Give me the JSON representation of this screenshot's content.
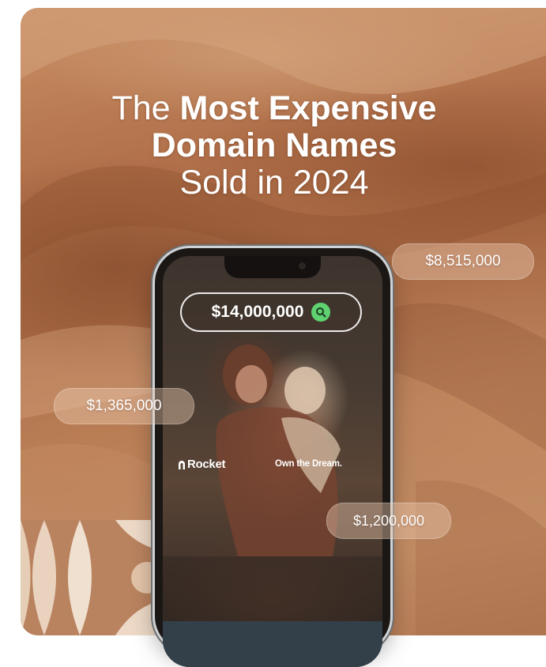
{
  "headline": {
    "line1_regular": "The",
    "line1_bold": "Most Expensive",
    "line2_bold": "Domain Names",
    "line3_regular": "Sold in 2024"
  },
  "phone": {
    "search_amount": "$14,000,000",
    "brand": "Rocket",
    "tagline": "Own the Dream."
  },
  "price_bubbles": [
    {
      "label": "$8,515,000"
    },
    {
      "label": "$1,365,000"
    },
    {
      "label": "$1,200,000"
    }
  ],
  "colors": {
    "sand": "#b57a55",
    "search_icon_green": "#5fd170",
    "text": "#ffffff"
  },
  "icons": [
    "search-icon",
    "rocket-logo-icon"
  ]
}
